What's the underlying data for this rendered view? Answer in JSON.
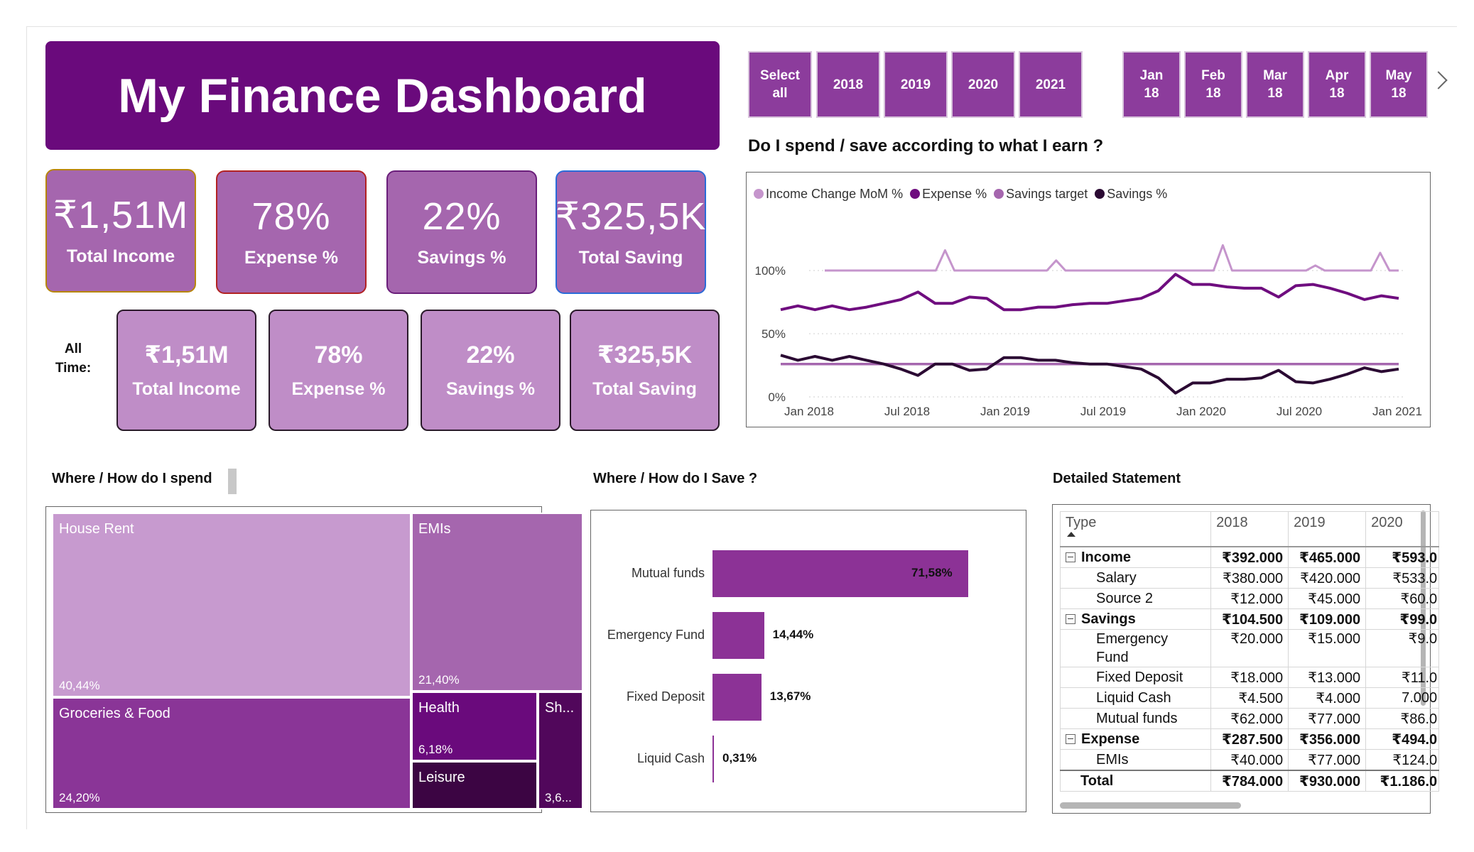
{
  "header": {
    "title": "My Finance Dashboard"
  },
  "kpis_top": [
    {
      "value": "₹1,51M",
      "label": "Total Income",
      "border": "#b8860b"
    },
    {
      "value": "78%",
      "label": "Expense %",
      "border": "#b22222"
    },
    {
      "value": "22%",
      "label": "Savings %",
      "border": "#6a1e7a"
    },
    {
      "value": "₹325,5K",
      "label": "Total Saving",
      "border": "#2a6bd8"
    }
  ],
  "all_time": {
    "label": "All Time:",
    "kpis": [
      {
        "value": "₹1,51M",
        "label": "Total Income"
      },
      {
        "value": "78%",
        "label": "Expense %"
      },
      {
        "value": "22%",
        "label": "Savings %"
      },
      {
        "value": "₹325,5K",
        "label": "Total Saving"
      }
    ]
  },
  "year_slicer": [
    "Select all",
    "2018",
    "2019",
    "2020",
    "2021"
  ],
  "month_slicer": [
    "Jan 18",
    "Feb 18",
    "Mar 18",
    "Apr 18",
    "May 18"
  ],
  "line_chart": {
    "title": "Do I spend / save according to what I earn ?",
    "legend": [
      {
        "name": "Income Change MoM %",
        "color": "#c595cc"
      },
      {
        "name": "Expense %",
        "color": "#6f0d7f"
      },
      {
        "name": "Savings target",
        "color": "#a566ae"
      },
      {
        "name": "Savings %",
        "color": "#2b0a33"
      }
    ],
    "y_ticks": [
      "100%",
      "50%",
      "0%"
    ],
    "x_ticks": [
      "Jan 2018",
      "Jul 2018",
      "Jan 2019",
      "Jul 2019",
      "Jan 2020",
      "Jul 2020",
      "Jan 2021"
    ]
  },
  "chart_data": [
    {
      "type": "line",
      "title": "Do I spend / save according to what I earn ?",
      "x_start": "Jan 2018",
      "x_end": "Jan 2021",
      "ylim": [
        0,
        1.2
      ],
      "y_ticks": [
        0,
        0.5,
        1.0
      ],
      "legend": "top-left",
      "series": [
        {
          "name": "Income Change MoM %",
          "values": [
            1.0,
            1.0,
            1.0,
            1.0,
            1.0,
            1.0,
            1.0,
            1.0,
            1.0,
            1.0,
            1.0,
            1.0,
            1.0,
            1.16,
            1.0,
            1.0,
            1.0,
            1.0,
            1.0,
            1.0,
            1.0,
            1.0,
            1.0,
            1.0,
            1.0,
            1.08,
            1.0,
            1.0,
            1.0,
            1.0,
            1.0,
            1.0,
            1.0,
            1.0,
            1.0,
            1.0,
            1.0,
            1.0,
            1.0,
            1.0,
            1.0,
            1.0,
            1.0,
            1.2,
            1.0,
            1.0,
            1.0,
            1.0,
            1.0,
            1.0,
            1.0,
            1.0,
            1.0,
            1.04,
            1.0,
            1.0,
            1.0,
            1.0,
            1.0,
            1.0,
            1.14,
            1.0,
            1.0
          ]
        },
        {
          "name": "Expense %",
          "values": [
            0.69,
            0.72,
            0.69,
            0.72,
            0.69,
            0.71,
            0.74,
            0.77,
            0.83,
            0.74,
            0.74,
            0.79,
            0.78,
            0.69,
            0.69,
            0.71,
            0.71,
            0.73,
            0.74,
            0.74,
            0.76,
            0.78,
            0.84,
            0.97,
            0.89,
            0.89,
            0.87,
            0.86,
            0.86,
            0.79,
            0.88,
            0.89,
            0.86,
            0.82,
            0.77,
            0.8,
            0.78
          ]
        },
        {
          "name": "Savings target",
          "values": [
            0.26,
            0.26
          ]
        },
        {
          "name": "Savings %",
          "values": [
            0.33,
            0.29,
            0.32,
            0.29,
            0.32,
            0.29,
            0.26,
            0.22,
            0.17,
            0.26,
            0.26,
            0.21,
            0.22,
            0.31,
            0.31,
            0.29,
            0.29,
            0.27,
            0.26,
            0.26,
            0.24,
            0.22,
            0.15,
            0.03,
            0.11,
            0.11,
            0.14,
            0.14,
            0.15,
            0.21,
            0.12,
            0.11,
            0.14,
            0.18,
            0.23,
            0.2,
            0.22
          ]
        }
      ]
    },
    {
      "type": "treemap",
      "title": "Where / How do I spend",
      "categories": [
        "House Rent",
        "EMIs",
        "Groceries & Food",
        "Health",
        "Leisure",
        "Sh..."
      ],
      "values": [
        40.44,
        21.4,
        24.2,
        6.18,
        4.2,
        3.6
      ]
    },
    {
      "type": "bar",
      "title": "Where / How do I Save ?",
      "categories": [
        "Mutual funds",
        "Emergency Fund",
        "Fixed Deposit",
        "Liquid Cash"
      ],
      "values": [
        71.58,
        14.44,
        13.67,
        0.31
      ],
      "labels": [
        "71,58%",
        "14,44%",
        "13,67%",
        "0,31%"
      ],
      "color": "#8c3296"
    }
  ],
  "treemap": {
    "title": "Where / How do I spend",
    "tiles": [
      {
        "name": "House Rent",
        "pct": "40,44%",
        "color": "#c79acf"
      },
      {
        "name": "EMIs",
        "pct": "21,40%",
        "color": "#a566ae"
      },
      {
        "name": "Groceries & Food",
        "pct": "24,20%",
        "color": "#8a3597"
      },
      {
        "name": "Health",
        "pct": "6,18%",
        "color": "#6a0a7c"
      },
      {
        "name": "Leisure",
        "pct": "",
        "color": "#3c0543"
      },
      {
        "name": "Sh...",
        "pct": "3,6...",
        "color": "#51075b"
      }
    ]
  },
  "savings_bars": {
    "title": "Where / How do I Save ?"
  },
  "statement": {
    "title": "Detailed  Statement",
    "columns": [
      "Type",
      "2018",
      "2019",
      "2020"
    ],
    "rows": [
      {
        "kind": "grp",
        "cells": [
          "Income",
          "₹392.000",
          "₹465.000",
          "₹593.0"
        ]
      },
      {
        "kind": "sub",
        "cells": [
          "Salary",
          "₹380.000",
          "₹420.000",
          "₹533.0"
        ]
      },
      {
        "kind": "sub",
        "cells": [
          "Source 2",
          "₹12.000",
          "₹45.000",
          "₹60.0"
        ]
      },
      {
        "kind": "grp",
        "cells": [
          "Savings",
          "₹104.500",
          "₹109.000",
          "₹99.0"
        ]
      },
      {
        "kind": "sub2",
        "cells": [
          "Emergency Fund",
          "₹20.000",
          "₹15.000",
          "₹9.0"
        ]
      },
      {
        "kind": "sub",
        "cells": [
          "Fixed Deposit",
          "₹18.000",
          "₹13.000",
          "₹11.0"
        ]
      },
      {
        "kind": "sub",
        "cells": [
          "Liquid Cash",
          "₹4.500",
          "₹4.000",
          "7.000"
        ]
      },
      {
        "kind": "sub",
        "cells": [
          "Mutual funds",
          "₹62.000",
          "₹77.000",
          "₹86.0"
        ]
      },
      {
        "kind": "grp",
        "cells": [
          "Expense",
          "₹287.500",
          "₹356.000",
          "₹494.0"
        ]
      },
      {
        "kind": "sub",
        "cells": [
          "EMIs",
          "₹40.000",
          "₹77.000",
          "₹124.0"
        ]
      },
      {
        "kind": "tot",
        "cells": [
          "Total",
          "₹784.000",
          "₹930.000",
          "₹1.186.0"
        ]
      }
    ]
  }
}
